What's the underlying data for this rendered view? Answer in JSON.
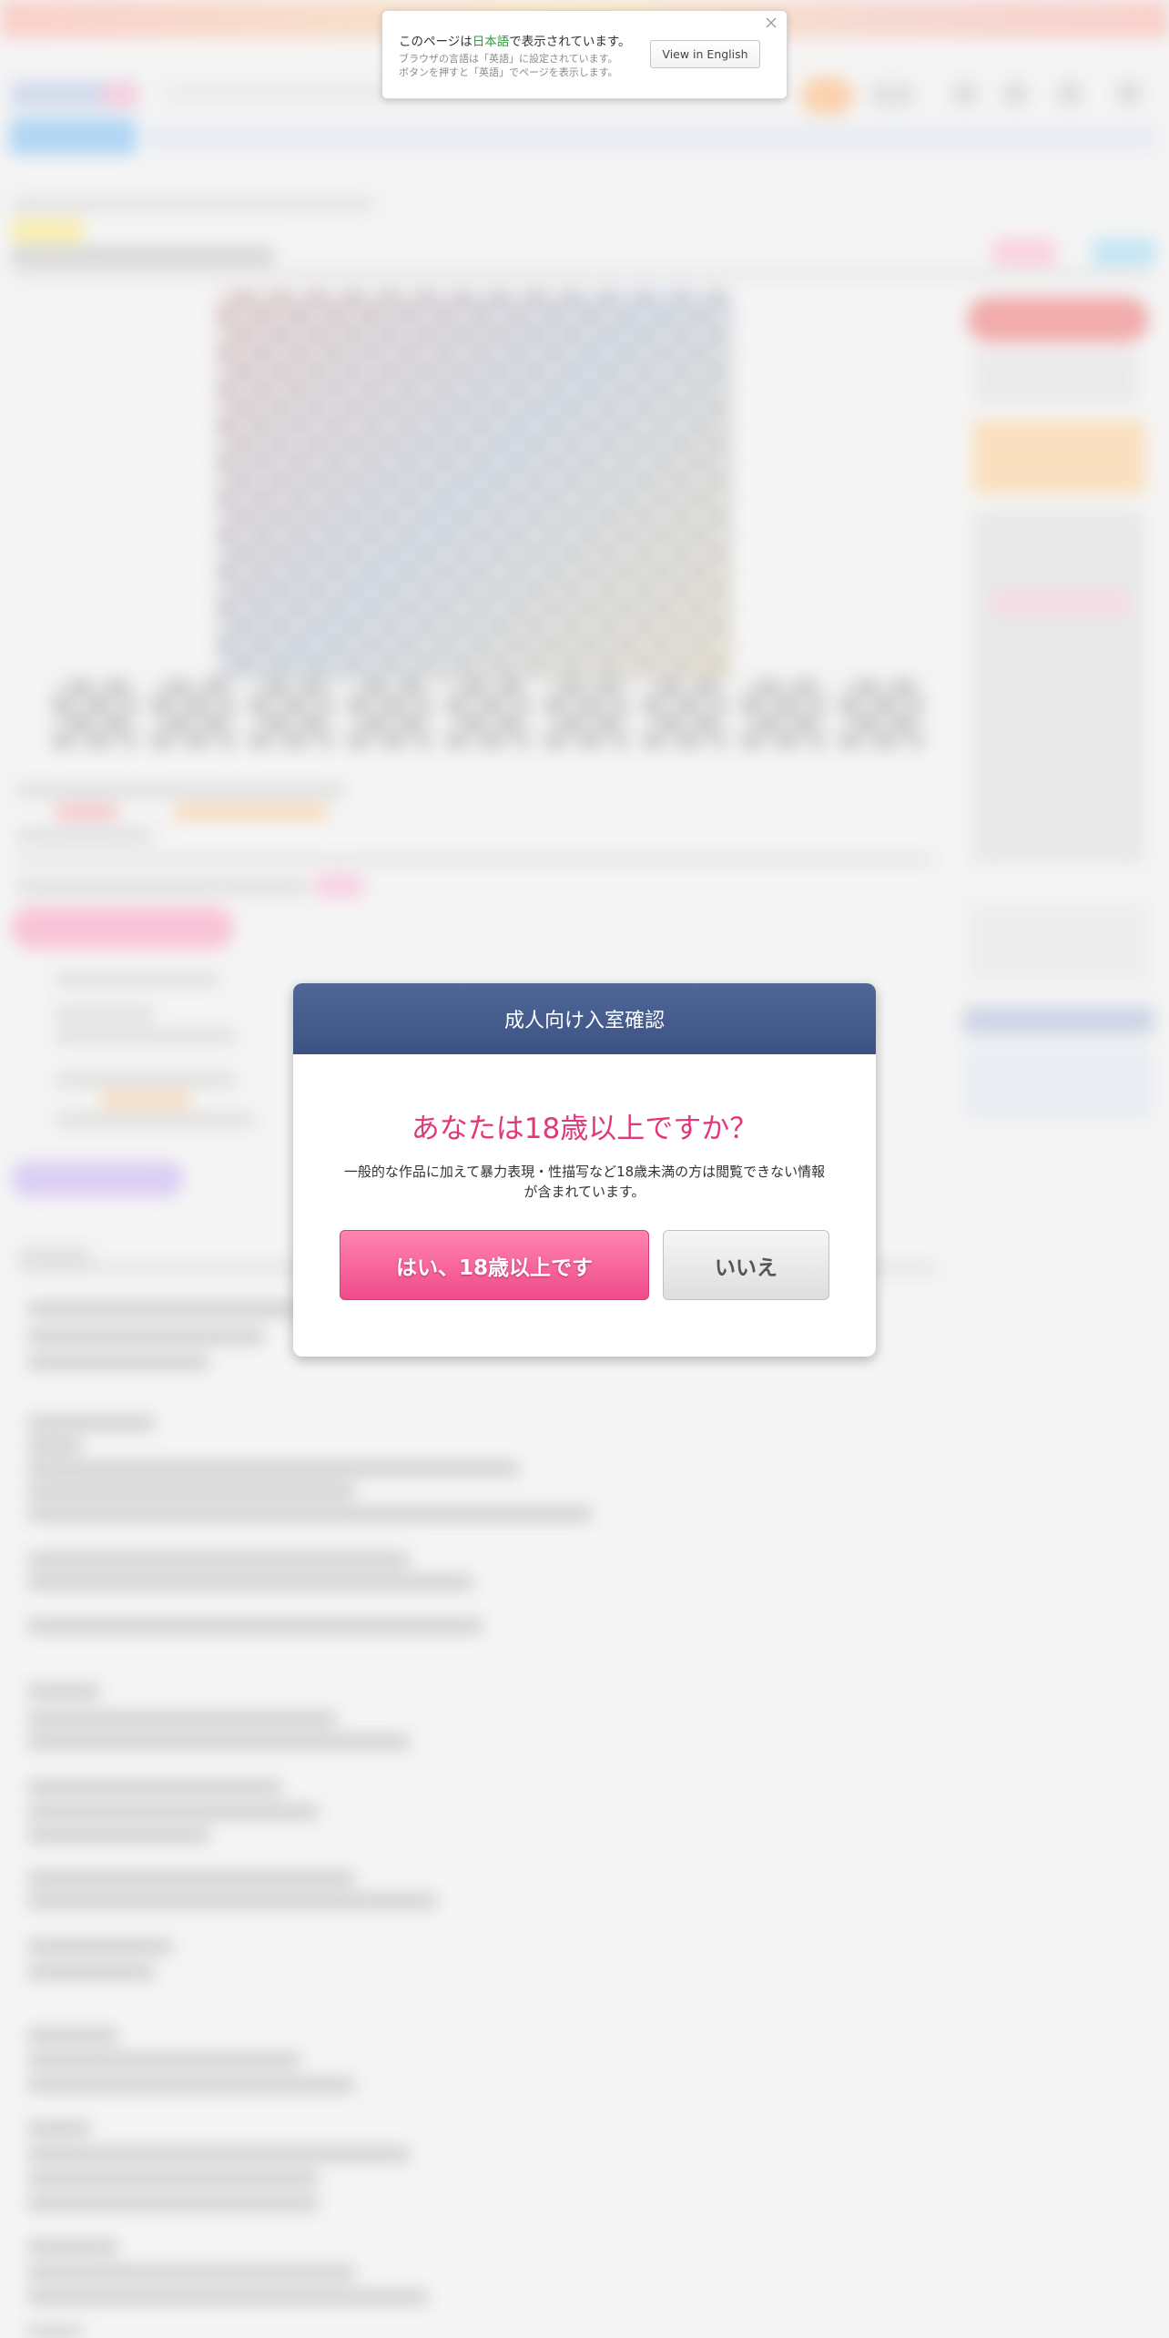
{
  "language_notice": {
    "message_prefix": "このページは",
    "message_language": "日本語",
    "message_suffix": "で表示されています。",
    "detail_line1": "ブラウザの言語は「英語」に設定されています。",
    "detail_line2": "ボタンを押すと「英語」でページを表示します。",
    "view_english_button": "View in English",
    "close_icon": "close-icon",
    "highlight_color": "#2e9a3e"
  },
  "age_modal": {
    "header": "成人向け入室確認",
    "question": "あなたは18歳以上ですか？",
    "description": "一般的な作品に加えて暴力表現・性描写など18歳未満の方は閲覧できない情報が含まれています。",
    "yes_button": "はい、18歳以上です",
    "no_button": "いいえ",
    "header_color": "#435a8c",
    "question_color": "#e0387a",
    "yes_color": "#f5589a"
  }
}
